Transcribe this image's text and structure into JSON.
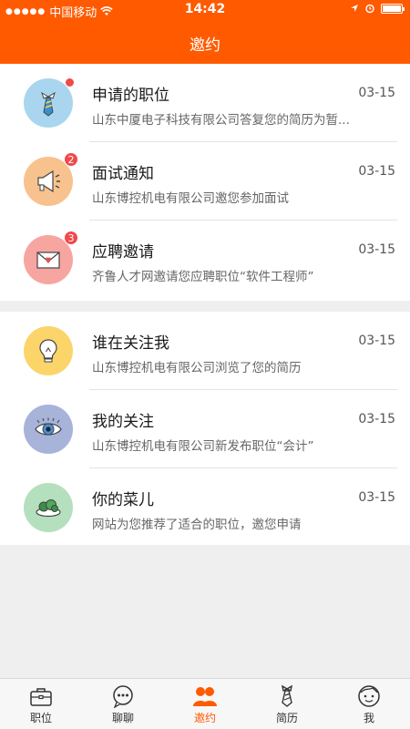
{
  "status_bar": {
    "carrier": "中国移动",
    "time": "14:42"
  },
  "header": {
    "title": "邀约"
  },
  "group1": [
    {
      "title": "申请的职位",
      "subtitle": "山东中厦电子科技有限公司答复您的简历为暂...",
      "date": "03-15",
      "badge_dot": true,
      "avatar_color": "#a9d6ee",
      "icon": "tie-icon"
    },
    {
      "title": "面试通知",
      "subtitle": "山东博控机电有限公司邀您参加面试",
      "date": "03-15",
      "badge": "2",
      "avatar_color": "#f8c28e",
      "icon": "megaphone-icon"
    },
    {
      "title": "应聘邀请",
      "subtitle": "齐鲁人才网邀请您应聘职位“软件工程师”",
      "date": "03-15",
      "badge": "3",
      "avatar_color": "#f7a5a1",
      "icon": "envelope-heart-icon"
    }
  ],
  "group2": [
    {
      "title": "谁在关注我",
      "subtitle": "山东博控机电有限公司浏览了您的简历",
      "date": "03-15",
      "avatar_color": "#fbd46a",
      "icon": "lightbulb-icon"
    },
    {
      "title": "我的关注",
      "subtitle": "山东博控机电有限公司新发布职位“会计”",
      "date": "03-15",
      "avatar_color": "#a7b3d9",
      "icon": "eye-icon"
    },
    {
      "title": "你的菜儿",
      "subtitle": "网站为您推荐了适合的职位，邀您申请",
      "date": "03-15",
      "avatar_color": "#b5e0be",
      "icon": "salad-bowl-icon"
    }
  ],
  "tabbar": [
    {
      "label": "职位",
      "icon": "briefcase-icon"
    },
    {
      "label": "聊聊",
      "icon": "chat-bubble-icon"
    },
    {
      "label": "邀约",
      "icon": "people-icon",
      "active": true
    },
    {
      "label": "简历",
      "icon": "tie-outline-icon"
    },
    {
      "label": "我",
      "icon": "smiley-face-icon"
    }
  ],
  "colors": {
    "accent": "#ff5a00",
    "badge": "#f04a4a"
  }
}
